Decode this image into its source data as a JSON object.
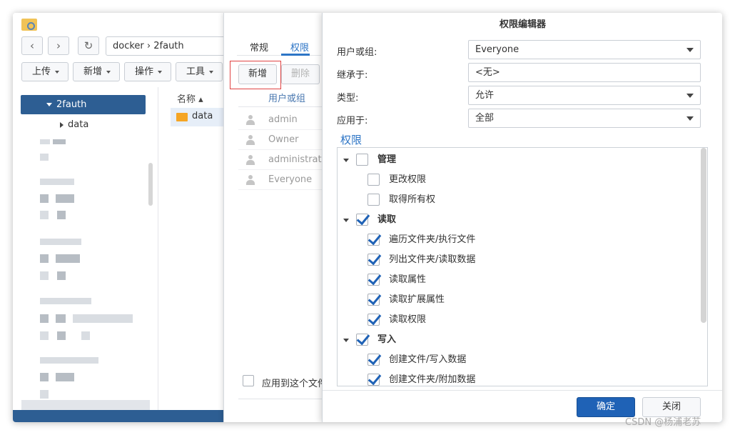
{
  "file_station": {
    "path": [
      "docker",
      "2fauth"
    ],
    "toolbar": [
      "上传",
      "新增",
      "操作",
      "工具"
    ],
    "tree_selected": "2fauth",
    "tree_child": "data",
    "list_header": "名称",
    "list_item": "data"
  },
  "properties": {
    "tabs": [
      "常规",
      "权限"
    ],
    "active_tab": "权限",
    "buttons": {
      "add": "新增",
      "delete": "删除"
    },
    "table_header": "用户或组",
    "rows": [
      "admin",
      "Owner",
      "administrators",
      "Everyone"
    ],
    "apply_label": "应用到这个文件"
  },
  "editor": {
    "title": "权限编辑器",
    "user_label": "用户或组:",
    "user_value": "Everyone",
    "inherit_label": "继承于:",
    "inherit_value": "<无>",
    "type_label": "类型:",
    "type_value": "允许",
    "apply_label": "应用于:",
    "apply_value": "全部",
    "section": "权限",
    "groups": [
      {
        "label": "管理",
        "checked": false,
        "items": [
          {
            "label": "更改权限",
            "checked": false
          },
          {
            "label": "取得所有权",
            "checked": false
          }
        ]
      },
      {
        "label": "读取",
        "checked": true,
        "items": [
          {
            "label": "遍历文件夹/执行文件",
            "checked": true
          },
          {
            "label": "列出文件夹/读取数据",
            "checked": true
          },
          {
            "label": "读取属性",
            "checked": true
          },
          {
            "label": "读取扩展属性",
            "checked": true
          },
          {
            "label": "读取权限",
            "checked": true
          }
        ]
      },
      {
        "label": "写入",
        "checked": true,
        "items": [
          {
            "label": "创建文件/写入数据",
            "checked": true
          },
          {
            "label": "创建文件夹/附加数据",
            "checked": true
          }
        ]
      }
    ],
    "ok_label": "确定",
    "close_label": "关闭"
  },
  "watermark": "CSDN @杨浦老苏",
  "colors": {
    "accent": "#1f62b6",
    "selection": "#2d5e93",
    "highlight": "#e04343"
  }
}
